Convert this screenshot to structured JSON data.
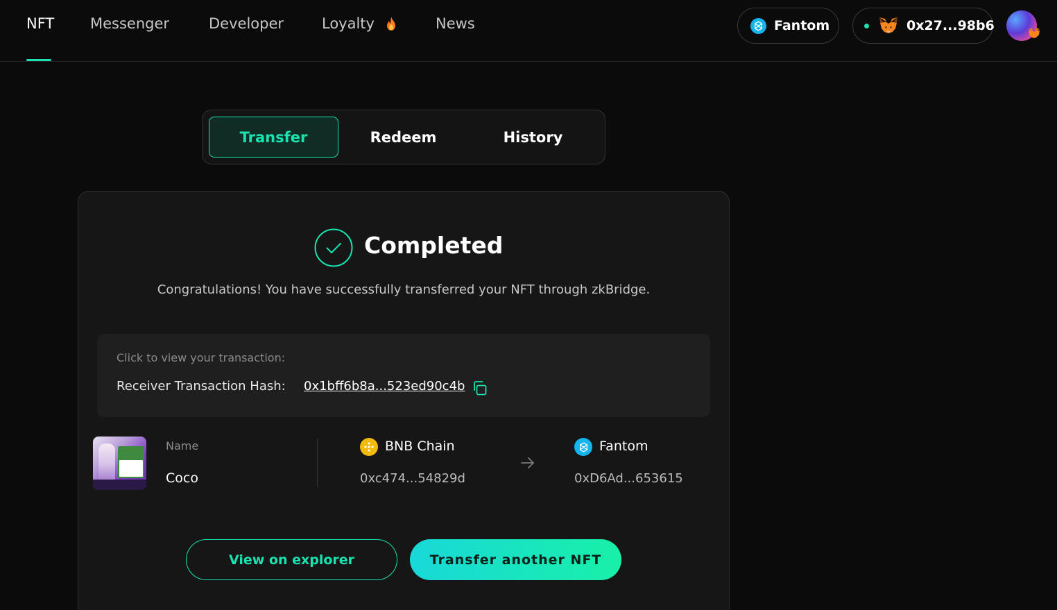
{
  "nav": {
    "items": [
      {
        "label": "NFT",
        "active": true
      },
      {
        "label": "Messenger",
        "active": false
      },
      {
        "label": "Developer",
        "active": false
      },
      {
        "label": "Loyalty",
        "active": false,
        "icon": "flame-icon"
      },
      {
        "label": "News",
        "active": false
      }
    ],
    "network": {
      "label": "Fantom",
      "icon": "fantom-icon"
    },
    "wallet": {
      "address": "0x27...98b6",
      "icon": "metamask-fox-icon",
      "status": "connected"
    },
    "avatar_icon": "avatar-icon"
  },
  "tabs": [
    {
      "label": "Transfer",
      "active": true
    },
    {
      "label": "Redeem",
      "active": false
    },
    {
      "label": "History",
      "active": false
    }
  ],
  "result": {
    "title": "Completed",
    "message": "Congratulations! You have successfully transferred your NFT through zkBridge.",
    "tx_hint": "Click to view your transaction:",
    "tx_label": "Receiver Transaction Hash:",
    "tx_hash": "0x1bff6b8a...523ed90c4b"
  },
  "nft": {
    "name_label": "Name",
    "name": "Coco",
    "source": {
      "chain": "BNB Chain",
      "address": "0xc474...54829d",
      "icon": "bnb-icon"
    },
    "destination": {
      "chain": "Fantom",
      "address": "0xD6Ad...653615",
      "icon": "fantom-icon"
    }
  },
  "buttons": {
    "explorer": "View on explorer",
    "transfer_another": "Transfer another NFT"
  },
  "colors": {
    "accent": "#19e3b0",
    "background": "#0b0b0b",
    "card": "#161616",
    "fantom": "#13b5ec",
    "bnb": "#f0b90b"
  }
}
